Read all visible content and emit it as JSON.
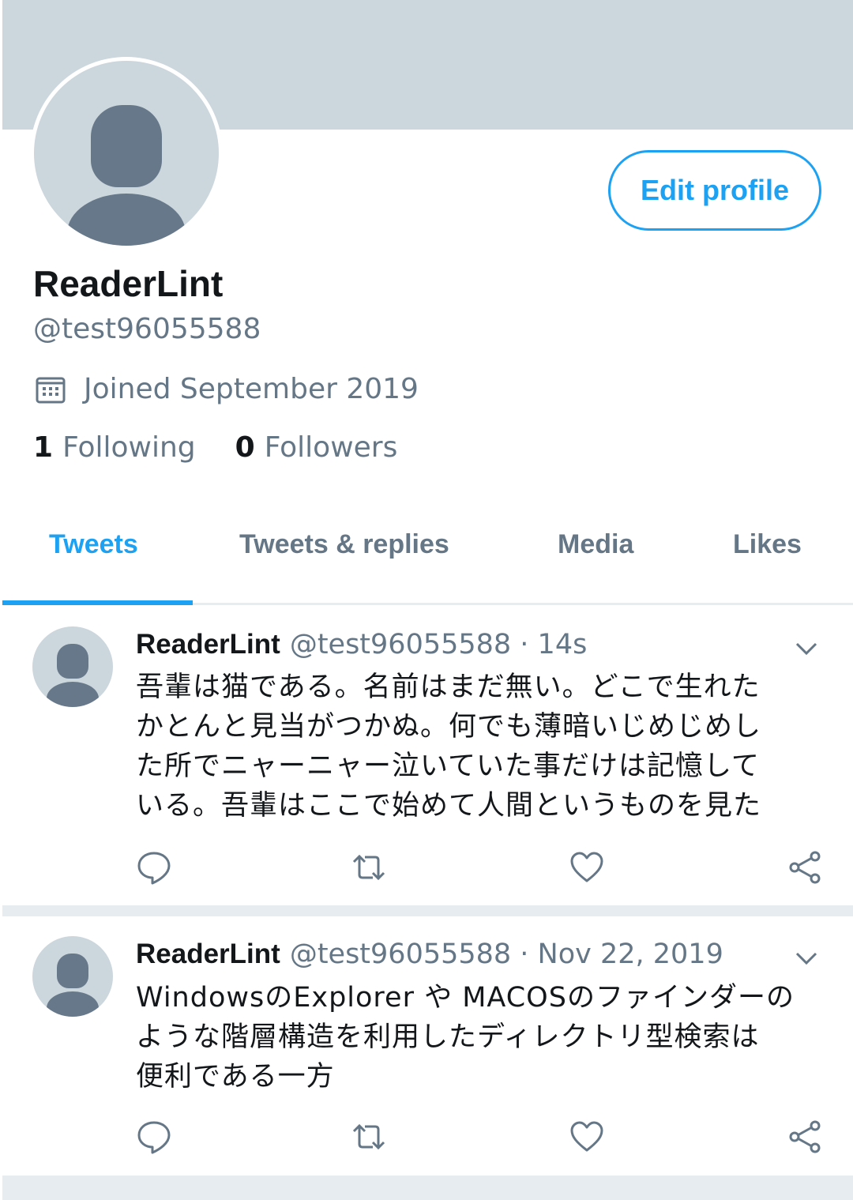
{
  "profile": {
    "display_name": "ReaderLint",
    "handle": "@test96055588",
    "joined": "Joined September 2019",
    "edit_button": "Edit profile",
    "following_count": "1",
    "following_label": "Following",
    "followers_count": "0",
    "followers_label": "Followers"
  },
  "tabs": [
    {
      "label": "Tweets",
      "active": true
    },
    {
      "label": "Tweets & replies",
      "active": false
    },
    {
      "label": "Media",
      "active": false
    },
    {
      "label": "Likes",
      "active": false
    }
  ],
  "tweets": [
    {
      "name": "ReaderLint",
      "meta": "@test96055588 · 14s",
      "lines": [
        "吾輩は猫である。名前はまだ無い。どこで生れた",
        "かとんと見当がつかぬ。何でも薄暗いじめじめし",
        "た所でニャーニャー泣いていた事だけは記憶して",
        "いる。吾輩はここで始めて人間というものを見た"
      ]
    },
    {
      "name": "ReaderLint",
      "meta": "@test96055588 · Nov 22, 2019",
      "lines": [
        "WindowsのExplorer や MACOSのファインダーの",
        "ような階層構造を利用したディレクトリ型検索は",
        "便利である一方"
      ]
    }
  ],
  "colors": {
    "accent": "#1da1f2",
    "banner": "#ccd6dd",
    "secondary_text": "#657786",
    "avatar_silhouette": "#67788a"
  }
}
